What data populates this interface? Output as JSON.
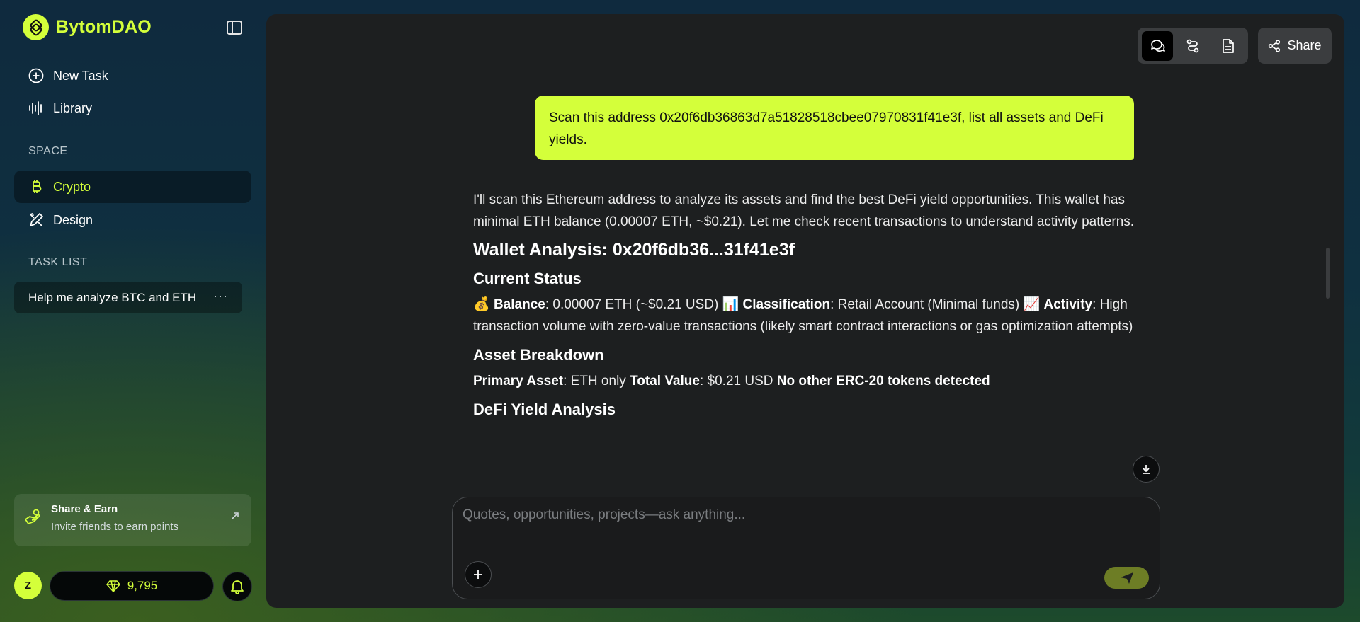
{
  "brand": {
    "name": "BytomDAO"
  },
  "nav": {
    "new_task": "New Task",
    "library": "Library"
  },
  "space": {
    "label": "SPACE",
    "items": [
      {
        "label": "Crypto",
        "active": true
      },
      {
        "label": "Design",
        "active": false
      }
    ]
  },
  "task_list": {
    "label": "TASK LIST",
    "items": [
      {
        "label": "Help me analyze BTC and ETH"
      }
    ]
  },
  "share_earn": {
    "title": "Share & Earn",
    "subtitle": "Invite friends to earn points"
  },
  "user": {
    "initial": "Z",
    "points": "9,795"
  },
  "toolbar": {
    "share_label": "Share"
  },
  "chat": {
    "user_message": "Scan this address 0x20f6db36863d7a51828518cbee07970831f41e3f, list all assets and DeFi yields.",
    "intro": "I'll scan this Ethereum address to analyze its assets and find the best DeFi yield opportunities. This wallet has minimal ETH balance (0.00007 ETH, ~$0.21). Let me check recent transactions to understand activity patterns.",
    "heading": "Wallet Analysis: 0x20f6db36...31f41e3f",
    "current_status": {
      "heading": "Current Status",
      "balance_emoji": "💰",
      "balance_label": "Balance",
      "balance_value": ": 0.00007 ETH (~$0.21 USD) ",
      "classification_emoji": "📊",
      "classification_label": "Classification",
      "classification_value": ": Retail Account (Minimal funds) ",
      "activity_emoji": "📈",
      "activity_label": "Activity",
      "activity_value": ": High transaction volume with zero-value transactions (likely smart contract interactions or gas optimization attempts)"
    },
    "asset_breakdown": {
      "heading": "Asset Breakdown",
      "primary_label": "Primary Asset",
      "primary_value": ": ETH only ",
      "total_label": "Total Value",
      "total_value": ": $0.21 USD ",
      "note": "No other ERC-20 tokens detected"
    },
    "defi_heading": "DeFi Yield Analysis"
  },
  "composer": {
    "placeholder": "Quotes, opportunities, projects—ask anything..."
  },
  "colors": {
    "accent": "#d4ff3a",
    "panel": "#1d1f20"
  }
}
